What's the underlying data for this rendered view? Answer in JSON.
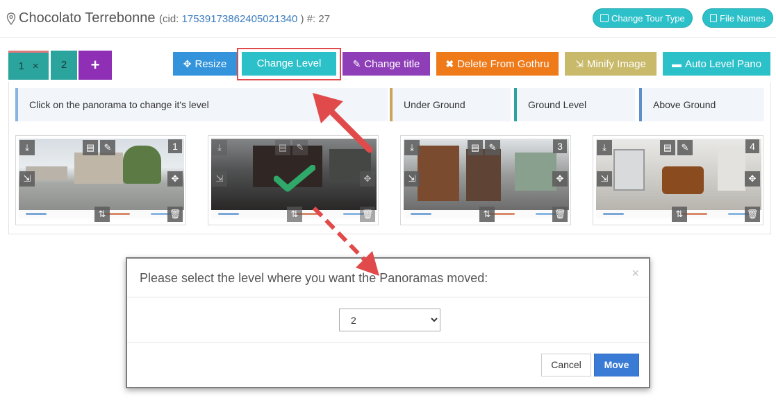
{
  "header": {
    "title": "Chocolato Terrebonne",
    "cid_label": "(cid:",
    "cid_value": "17539173862405021340",
    "cid_suffix": ") #: 27",
    "buttons": {
      "change_tour_type": "Change Tour Type",
      "file_names": "File Names"
    }
  },
  "tabs": {
    "tab1_label": "1",
    "tab1_close": "×",
    "tab2_label": "2",
    "add_label": "+"
  },
  "toolbar": {
    "resize": "Resize",
    "change_level": "Change Level",
    "change_title": "Change title",
    "delete": "Delete From Gothru",
    "minify": "Minify Image",
    "auto_level": "Auto Level Pano"
  },
  "legend": {
    "info": "Click on the panorama to change it's level",
    "under": "Under Ground",
    "ground": "Ground Level",
    "above": "Above Ground"
  },
  "panoramas": [
    {
      "number": "1",
      "selected": false
    },
    {
      "number": "",
      "selected": true
    },
    {
      "number": "3",
      "selected": false
    },
    {
      "number": "4",
      "selected": false
    }
  ],
  "modal": {
    "title": "Please select the level where you want the Panoramas moved:",
    "close": "×",
    "selected_level": "2",
    "cancel": "Cancel",
    "move": "Move"
  },
  "colors": {
    "teal": "#2cc0c9",
    "purple": "#8e3fb8",
    "orange": "#ee7a1a",
    "blue": "#3394dc",
    "annotation_red": "#e14a4a",
    "check_green": "#2fa86a"
  },
  "icons": [
    "map-pin-icon",
    "edit-icon",
    "file-icon",
    "move-icon",
    "pencil-icon",
    "close-icon",
    "compress-icon",
    "ruler-icon",
    "download-icon",
    "trash-icon",
    "check-icon",
    "arrow-icon"
  ]
}
